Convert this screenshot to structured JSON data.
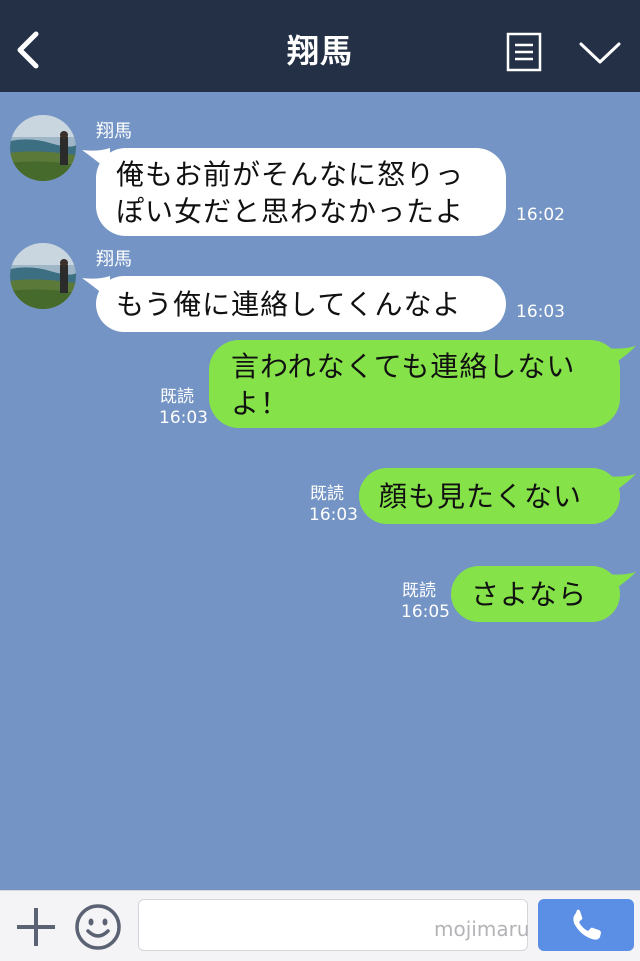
{
  "header": {
    "title": "翔馬"
  },
  "messages": [
    {
      "side": "left",
      "sender": "翔馬",
      "lines": [
        "俺もお前がそんなに怒りっ",
        "ぽい女だと思わなかったよ"
      ],
      "time": "16:02"
    },
    {
      "side": "left",
      "sender": "翔馬",
      "lines": [
        "もう俺に連絡してくんなよ"
      ],
      "time": "16:03"
    },
    {
      "side": "right",
      "read": "既読",
      "lines": [
        "言われなくても連絡しない",
        "よ！"
      ],
      "time": "16:03"
    },
    {
      "side": "right",
      "read": "既読",
      "lines": [
        "顔も見たくない"
      ],
      "time": "16:03"
    },
    {
      "side": "right",
      "read": "既読",
      "lines": [
        "さよなら"
      ],
      "time": "16:05"
    }
  ],
  "input": {
    "value": "",
    "watermark": "mojimaru"
  },
  "icons": {
    "back": "chevron-left-icon",
    "menu": "note-icon",
    "collapse": "chevron-down-icon",
    "plus": "plus-icon",
    "emoji": "smiley-icon",
    "call": "phone-icon"
  },
  "colors": {
    "header": "#243045",
    "background": "#7394c4",
    "sent_bubble": "#85e249",
    "received_bubble": "#ffffff",
    "call_button": "#5b8ee5"
  }
}
